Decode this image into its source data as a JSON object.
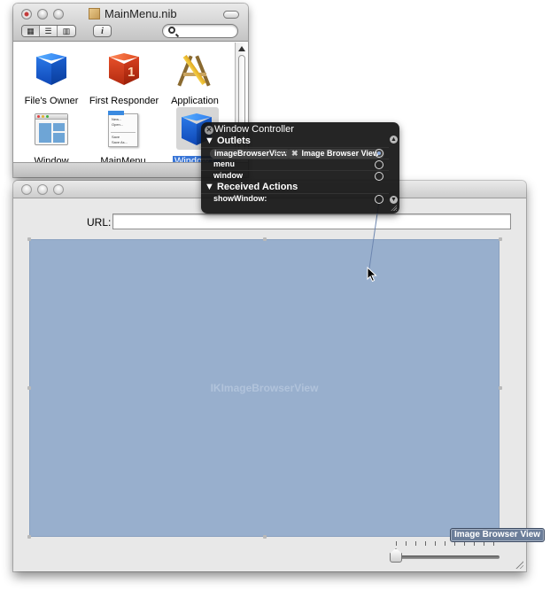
{
  "nib_window": {
    "title": "MainMenu.nib",
    "toolbar": {
      "view_modes": [
        {
          "name": "icon-view",
          "glyph": "▦",
          "selected": true
        },
        {
          "name": "list-view",
          "glyph": "☰",
          "selected": false
        },
        {
          "name": "column-view",
          "glyph": "▥",
          "selected": false
        }
      ],
      "info_glyph": "i",
      "search_placeholder": ""
    },
    "objects": [
      {
        "label": "File's Owner",
        "icon": "blue-cube-icon",
        "selected": false
      },
      {
        "label": "First Responder",
        "icon": "first-responder-icon",
        "selected": false
      },
      {
        "label": "Application",
        "icon": "application-icon",
        "selected": false
      },
      {
        "label": "Window",
        "icon": "window-icon",
        "selected": false
      },
      {
        "label": "MainMenu",
        "icon": "menu-icon",
        "selected": false
      },
      {
        "label": "Window Controller",
        "label_visible": "Window C",
        "icon": "blue-cube-icon",
        "selected": true
      }
    ],
    "menu_icon_items": [
      "New...",
      "Open...",
      "Save",
      "Save As..."
    ],
    "first_responder_glyph": "1"
  },
  "connections_panel": {
    "title": "Window Controller",
    "sections": [
      {
        "label": "Outlets",
        "rows": [
          {
            "name": "imageBrowserView",
            "connected_to": "Image Browser View",
            "connected": true
          },
          {
            "name": "menu",
            "connected_to": null,
            "connected": false
          },
          {
            "name": "window",
            "connected_to": null,
            "connected": false
          }
        ]
      },
      {
        "label": "Received Actions",
        "rows": [
          {
            "name": "showWindow:",
            "connected_to": null,
            "connected": false
          }
        ]
      }
    ],
    "disclosure_glyph": "▼",
    "close_glyph": "✕",
    "disconnect_glyph": "✖"
  },
  "app_window": {
    "url_label": "URL:",
    "url_value": "",
    "browser_view_label": "IKImageBrowserView",
    "zoom_slider": {
      "value": 0.0,
      "tick_count": 11
    }
  },
  "tooltip": "Image Browser View",
  "colors": {
    "selection": "#3875d7",
    "browser_view": "#98afcd",
    "hud_bg": "#141414",
    "tooltip_bg": "#6b7d99"
  }
}
